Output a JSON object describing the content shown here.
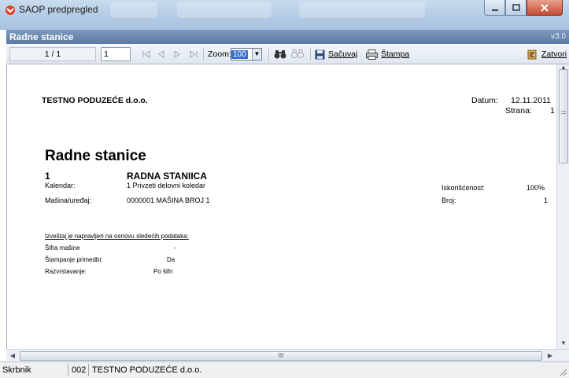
{
  "window": {
    "title": "SAOP predpregled",
    "colors": {
      "titlebar": "#b6cde6",
      "close_button": "#c44a31"
    }
  },
  "report_bar": {
    "title": "Radne stanice",
    "version": "v3.0"
  },
  "toolbar": {
    "page_count": "1 / 1",
    "page_input": "1",
    "zoom_label": "Zoom:",
    "zoom_value": "100",
    "save_label": "Sačuvaj",
    "print_label": "Štampa",
    "close_label": "Zatvori"
  },
  "report": {
    "company": "TESTNO PODUZEĆE d.o.o.",
    "date_label": "Datum:",
    "date_value": "12.11.2011",
    "page_label": "Strana:",
    "page_value": "1",
    "heading": "Radne stanice",
    "station": {
      "number": "1",
      "name": "RADNA STANIICA",
      "calendar_label": "Kalendar:",
      "calendar_value": "1 Privzeti delovni koledar",
      "machine_label": "Mašina/uređaj:",
      "machine_value": "0000001 MAŠINA BROJ 1",
      "utilization_label": "Iskorišćenost:",
      "utilization_value": "100%",
      "count_label": "Broj:",
      "count_value": "1"
    },
    "basis": {
      "title": "Izveštaj je napravljen na osnovu sledećih podataka:",
      "rows": [
        {
          "label": "Šifra mašine",
          "value": "-"
        },
        {
          "label": "Štampanje primedbi:",
          "value": "Da"
        },
        {
          "label": "Razvrstavanje:",
          "value": "Po šifri"
        }
      ]
    }
  },
  "statusbar": {
    "user_label": "Skrbnik",
    "company_code": "002",
    "company_name": "TESTNO PODUZEĆE d.o.o."
  },
  "scroll": {
    "hscroll_grip": "III"
  }
}
